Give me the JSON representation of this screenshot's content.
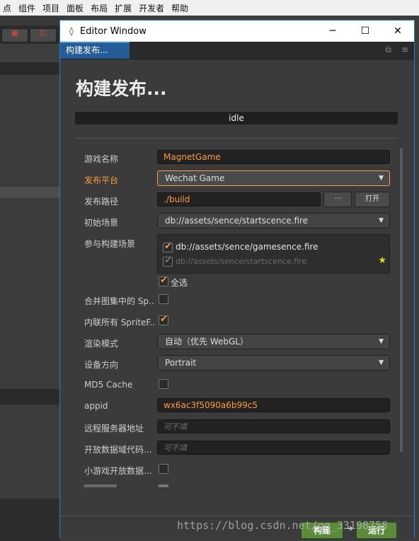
{
  "menu": [
    "点",
    "组件",
    "项目",
    "面板",
    "布局",
    "扩展",
    "开发者",
    "帮助"
  ],
  "window": {
    "title": "Editor Window",
    "minimize_glyph": "─",
    "maximize_glyph": "☐",
    "close_glyph": "✕"
  },
  "tab": {
    "label": "构建发布..."
  },
  "page": {
    "title": "构建发布...",
    "status": "idle"
  },
  "form": {
    "game_name": {
      "label": "游戏名称",
      "value": "MagnetGame"
    },
    "platform": {
      "label": "发布平台",
      "value": "Wechat Game"
    },
    "path": {
      "label": "发布路径",
      "value": "./build",
      "browse_label": "···",
      "open_label": "打开"
    },
    "start_scene": {
      "label": "初始场景",
      "value": "db://assets/sence/startscence.fire"
    },
    "scenes": {
      "label": "参与构建场景",
      "items": [
        {
          "path": "db://assets/sence/gamesence.fire",
          "checked": true
        },
        {
          "path": "db://assets/sence/startscence.fire",
          "checked": true
        }
      ],
      "select_all_label": "全选"
    },
    "merge_atlas": {
      "label": "合并图集中的 Sp..",
      "checked": false
    },
    "inline_sprite": {
      "label": "内联所有 SpriteF..",
      "checked": true
    },
    "render_mode": {
      "label": "渲染模式",
      "value": "自动（优先 WebGL）"
    },
    "orientation": {
      "label": "设备方向",
      "value": "Portrait"
    },
    "md5": {
      "label": "MD5 Cache",
      "checked": false
    },
    "appid": {
      "label": "appid",
      "value": "wx6ac3f5090a6b99c5"
    },
    "remote_server": {
      "label": "远程服务器地址",
      "placeholder": "可不填"
    },
    "open_data": {
      "label": "开放数据域代码...",
      "placeholder": "可不填"
    },
    "open_data_ctx": {
      "label": "小游戏开放数据...",
      "checked": false
    }
  },
  "footer": {
    "build_label": "构建",
    "run_label": "运行"
  },
  "watermark": "https://blog.csdn.net/qq_33198758"
}
